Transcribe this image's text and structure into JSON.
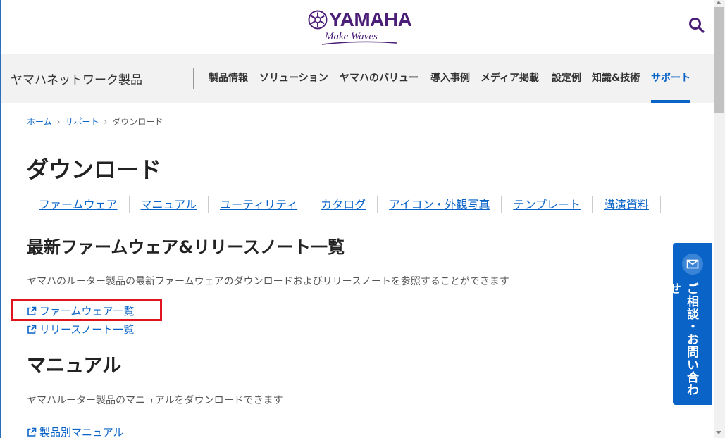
{
  "header": {
    "logo_word": "YAMAHA",
    "logo_tagline": "Make Waves",
    "search_icon": "search-icon"
  },
  "nav": {
    "brand": "ヤマハネットワーク製品",
    "items": [
      {
        "label": "製品情報"
      },
      {
        "label": "ソリューション"
      },
      {
        "label": "ヤマハのバリュー"
      },
      {
        "label": "導入事例"
      },
      {
        "label": "メディア掲載"
      },
      {
        "label": "設定例"
      },
      {
        "label": "知識&技術"
      },
      {
        "label": "サポート",
        "active": true
      }
    ]
  },
  "breadcrumb": {
    "items": [
      "ホーム",
      "サポート",
      "ダウンロード"
    ]
  },
  "page": {
    "title": "ダウンロード",
    "subnav": [
      "ファームウェア",
      "マニュアル",
      "ユーティリティ",
      "カタログ",
      "アイコン・外観写真",
      "テンプレート",
      "講演資料"
    ]
  },
  "sections": {
    "firmware": {
      "title": "最新ファームウェア&リリースノート一覧",
      "desc": "ヤマハのルーター製品の最新ファームウェアのダウンロードおよびリリースノートを参照することができます",
      "links": [
        "ファームウェア一覧",
        "リリースノート一覧"
      ]
    },
    "manual": {
      "title": "マニュアル",
      "desc": "ヤマハルーター製品のマニュアルをダウンロードできます",
      "links": [
        "製品別マニュアル"
      ]
    }
  },
  "contact": {
    "label": "ご相談・お問い合わせ",
    "icon": "mail-icon"
  },
  "colors": {
    "accent": "#0a64c8",
    "brand_purple": "#4b1e78",
    "highlight": "#e0141e"
  }
}
